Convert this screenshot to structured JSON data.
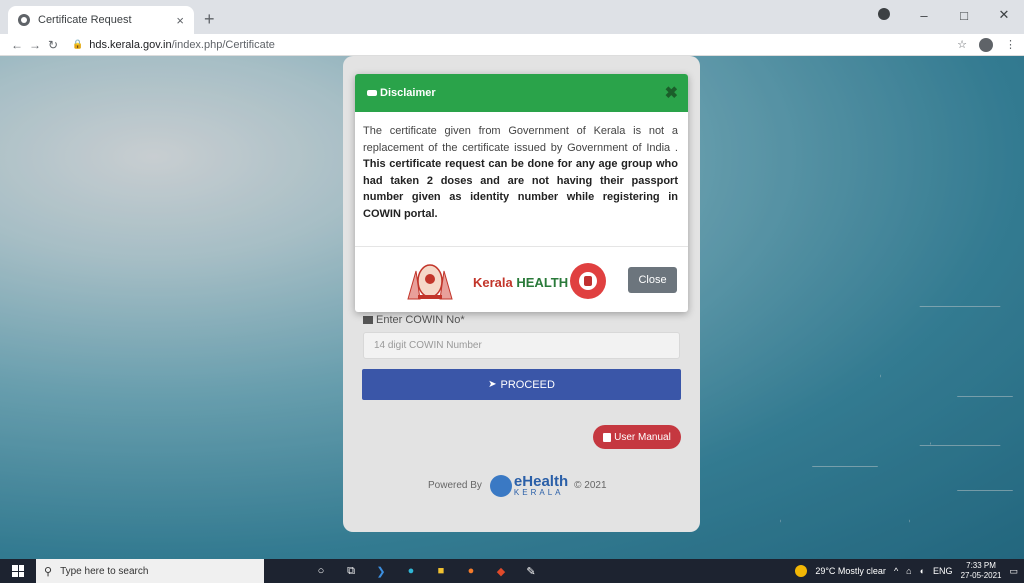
{
  "browser": {
    "tab_title": "Certificate Request",
    "tab_close": "×",
    "new_tab": "+",
    "url_host": "hds.kerala.gov.in",
    "url_path": "/index.php/Certificate"
  },
  "page": {
    "field_label": "Enter COWIN No*",
    "field_placeholder": "14 digit COWIN Number",
    "proceed_label": "PROCEED",
    "user_manual_label": "User Manual",
    "powered_by": "Powered By",
    "ehealth_name": "eHealth",
    "ehealth_sub": "KERALA",
    "copyright": "© 2021"
  },
  "modal": {
    "title": "Disclaimer",
    "close_x": "✖",
    "body_plain": "The certificate given from Government of Kerala is not a replacement of the certificate issued by Government of India . ",
    "body_bold": "This certificate request can be done for any age group who had taken 2 doses and are not having their passport number given as identity number while registering in COWIN portal.",
    "brand_kerala": "Kerala",
    "brand_health": "HEALTH",
    "close_button": "Close"
  },
  "taskbar": {
    "search_placeholder": "Type here to search",
    "weather": "29°C  Mostly clear",
    "language": "ENG",
    "time": "7:33 PM",
    "date": "27-05-2021"
  },
  "colors": {
    "modal_header": "#2aa34a",
    "proceed": "#3a56a8",
    "user_manual": "#c53840",
    "close_button": "#6c757d"
  }
}
